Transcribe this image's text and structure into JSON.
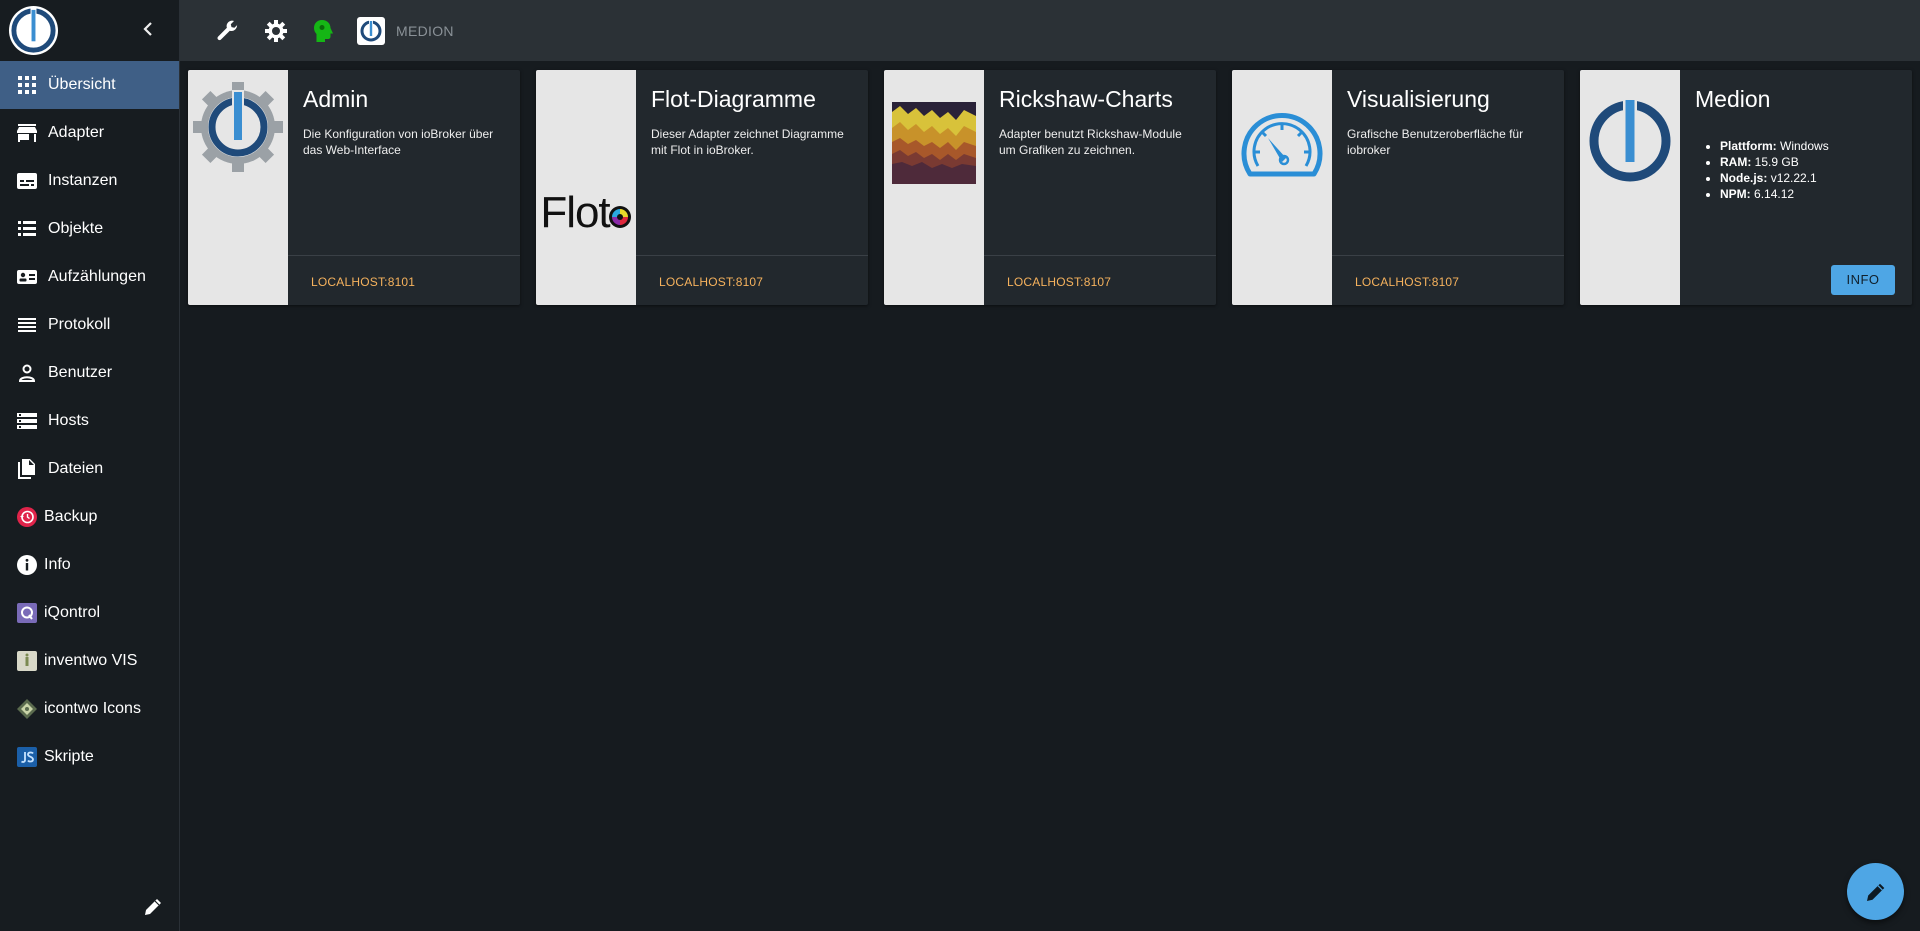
{
  "host": {
    "name": "MEDION"
  },
  "sidebar": {
    "items": [
      {
        "label": "Übersicht",
        "icon": "apps-grid-icon",
        "active": true
      },
      {
        "label": "Adapter",
        "icon": "store-icon"
      },
      {
        "label": "Instanzen",
        "icon": "subtitles-icon"
      },
      {
        "label": "Objekte",
        "icon": "list-icon"
      },
      {
        "label": "Aufzählungen",
        "icon": "contact-card-icon"
      },
      {
        "label": "Protokoll",
        "icon": "lines-icon"
      },
      {
        "label": "Benutzer",
        "icon": "person-icon"
      },
      {
        "label": "Hosts",
        "icon": "storage-icon"
      },
      {
        "label": "Dateien",
        "icon": "files-icon"
      },
      {
        "label": "Backup",
        "icon": "backup-icon"
      },
      {
        "label": "Info",
        "icon": "info-icon"
      },
      {
        "label": "iQontrol",
        "icon": "iqontrol-icon"
      },
      {
        "label": "inventwo VIS",
        "icon": "inventwo-icon"
      },
      {
        "label": "icontwo Icons",
        "icon": "icontwo-icon"
      },
      {
        "label": "Skripte",
        "icon": "javascript-icon"
      }
    ]
  },
  "cards": [
    {
      "title": "Admin",
      "description": "Die Konfiguration von ioBroker über das Web-Interface",
      "link": "LOCALHOST:8101"
    },
    {
      "title": "Flot-Diagramme",
      "description": "Dieser Adapter zeichnet Diagramme mit Flot in ioBroker.",
      "link": "LOCALHOST:8107",
      "logo_text": "Flot"
    },
    {
      "title": "Rickshaw-Charts",
      "description": "Adapter benutzt Rickshaw-Module um Grafiken zu zeichnen.",
      "link": "LOCALHOST:8107"
    },
    {
      "title": "Visualisierung",
      "description": "Grafische Benutzeroberfläche für iobroker",
      "link": "LOCALHOST:8107"
    }
  ],
  "host_card": {
    "title": "Medion",
    "info": [
      {
        "key": "Plattform:",
        "value": "Windows"
      },
      {
        "key": "RAM:",
        "value": "15.9 GB"
      },
      {
        "key": "Node.js:",
        "value": "v12.22.1"
      },
      {
        "key": "NPM:",
        "value": "6.14.12"
      }
    ],
    "button": "INFO"
  },
  "colors": {
    "accent": "#4ea6e5",
    "active_nav": "#3f5f86",
    "link": "#f6b25d",
    "iobroker_blue": "#1f4a7a"
  }
}
